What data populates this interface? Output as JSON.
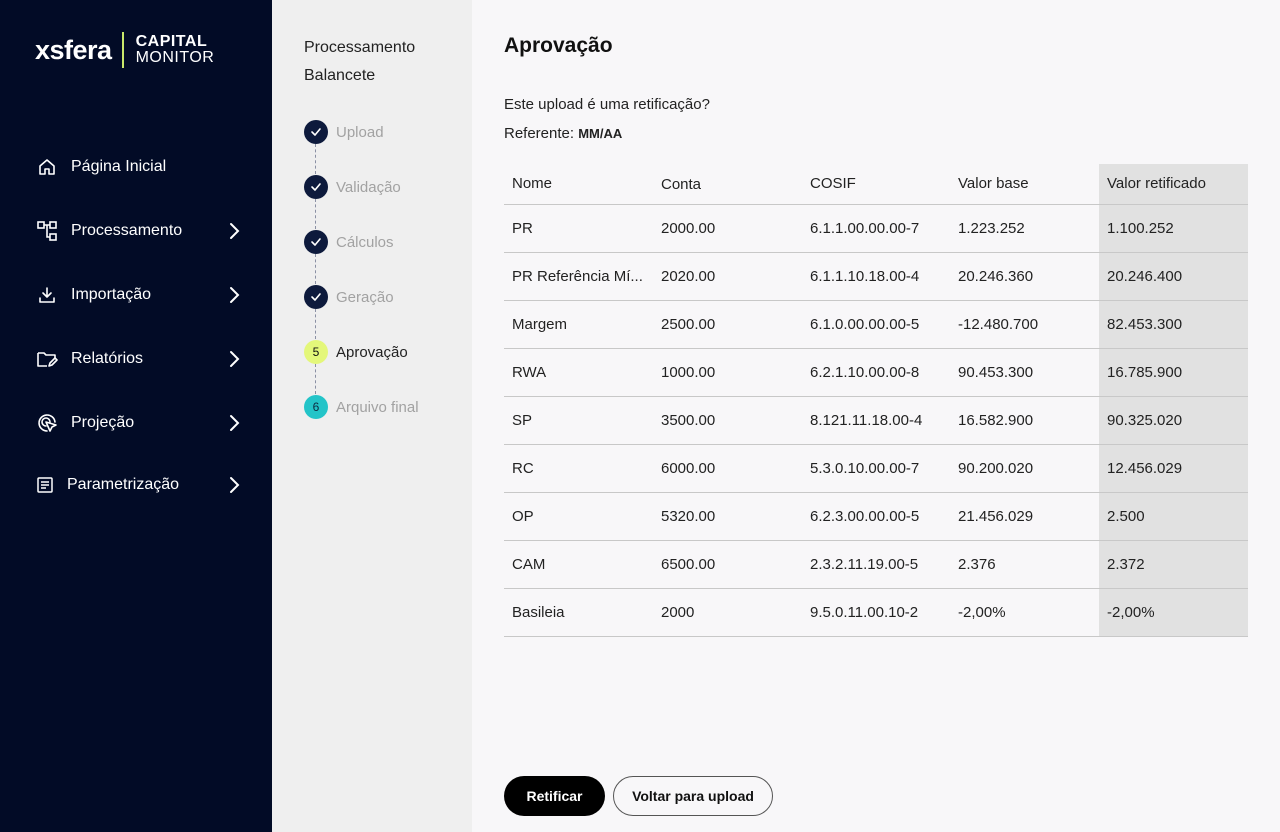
{
  "brand": {
    "name": "xsfera",
    "line1": "CAPITAL",
    "line2": "MONITOR"
  },
  "nav": [
    {
      "label": "Página Inicial",
      "icon": "home-icon",
      "chevron": false
    },
    {
      "label": "Processamento",
      "icon": "flow-icon",
      "chevron": true
    },
    {
      "label": "Importação",
      "icon": "download-icon",
      "chevron": true
    },
    {
      "label": "Relatórios",
      "icon": "folder-edit-icon",
      "chevron": true
    },
    {
      "label": "Projeção",
      "icon": "target-icon",
      "chevron": true
    },
    {
      "label": "Parametrização",
      "icon": "form-icon",
      "chevron": true
    }
  ],
  "stepper": {
    "title": "Processamento Balancete",
    "steps": [
      {
        "label": "Upload",
        "state": "done"
      },
      {
        "label": "Validação",
        "state": "done"
      },
      {
        "label": "Cálculos",
        "state": "done"
      },
      {
        "label": "Geração",
        "state": "done"
      },
      {
        "label": "Aprovação",
        "state": "current",
        "number": "5"
      },
      {
        "label": "Arquivo final",
        "state": "next",
        "number": "6"
      }
    ]
  },
  "main": {
    "title": "Aprovação",
    "question": "Este upload é uma retificação?",
    "ref_label": "Referente:",
    "ref_value": "MM/AA"
  },
  "table": {
    "headers": [
      "Nome",
      "Conta",
      "COSIF",
      "Valor base",
      "Valor retificado"
    ],
    "rows": [
      [
        "PR",
        "2000.00",
        "6.1.1.00.00.00-7",
        "1.223.252",
        "1.100.252"
      ],
      [
        "PR Referência Mí...",
        "2020.00",
        "6.1.1.10.18.00-4",
        "20.246.360",
        "20.246.400"
      ],
      [
        "Margem",
        "2500.00",
        "6.1.0.00.00.00-5",
        "-12.480.700",
        "82.453.300"
      ],
      [
        "RWA",
        "1000.00",
        "6.2.1.10.00.00-8",
        "90.453.300",
        "16.785.900"
      ],
      [
        "SP",
        "3500.00",
        "8.121.11.18.00-4",
        "16.582.900",
        "90.325.020"
      ],
      [
        "RC",
        "6000.00",
        "5.3.0.10.00.00-7",
        "90.200.020",
        "12.456.029"
      ],
      [
        "OP",
        "5320.00",
        "6.2.3.00.00.00-5",
        "21.456.029",
        "2.500"
      ],
      [
        "CAM",
        "6500.00",
        "2.3.2.11.19.00-5",
        "2.376",
        "2.372"
      ],
      [
        "Basileia",
        "2000",
        "9.5.0.11.00.10-2",
        "-2,00%",
        "-2,00%"
      ]
    ]
  },
  "buttons": {
    "primary": "Retificar",
    "secondary": "Voltar para upload"
  },
  "colors": {
    "sidebar": "#020b26",
    "accent": "#c9e86b",
    "current_step": "#e4f77a",
    "next_step": "#23c4c8"
  }
}
